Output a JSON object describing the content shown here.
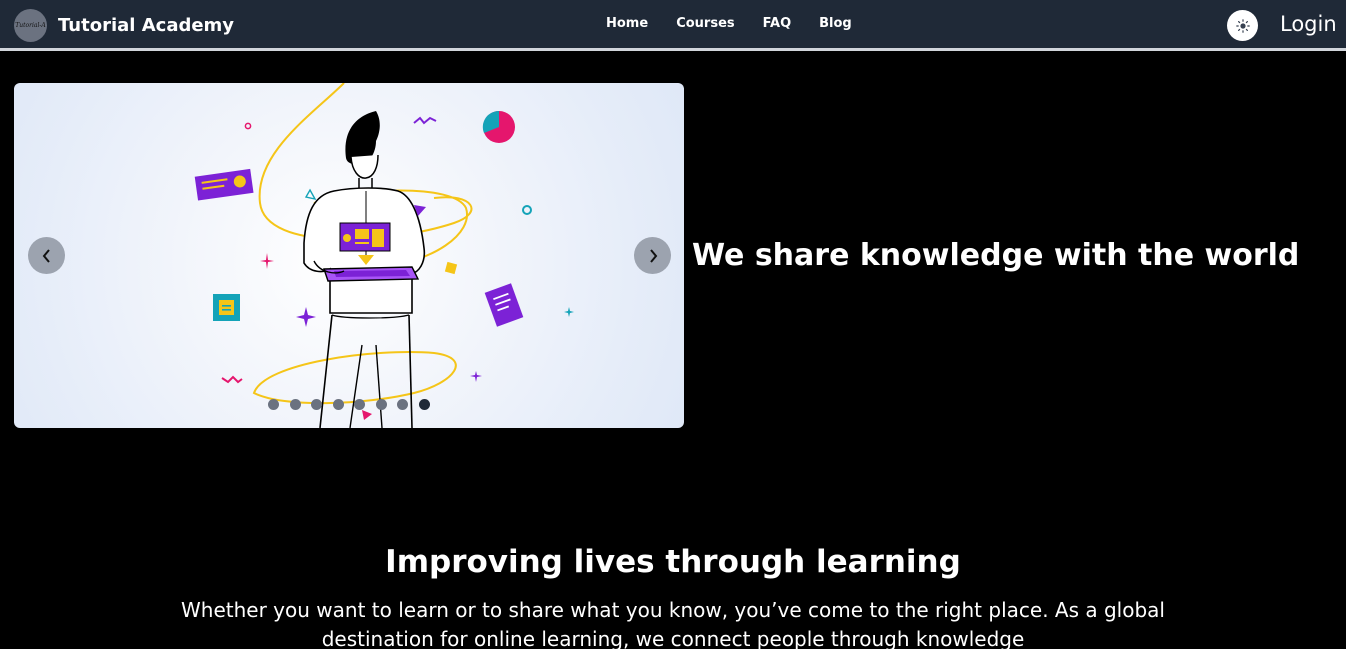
{
  "brand": {
    "logo_text": "Tutorial-A",
    "name": "Tutorial Academy"
  },
  "nav": {
    "items": [
      "Home",
      "Courses",
      "FAQ",
      "Blog"
    ]
  },
  "header": {
    "theme_toggle_icon": "sun-icon",
    "login_label": "Login"
  },
  "carousel": {
    "prev_icon": "chevron-left-icon",
    "next_icon": "chevron-right-icon",
    "slide_count": 8,
    "active_index": 7,
    "illustration": "person-with-tablet-illustration"
  },
  "hero": {
    "heading": "We share knowledge with the world"
  },
  "section": {
    "title": "Improving lives through learning",
    "text": "Whether you want to learn or to share what you know, you’ve come to the right place. As a global destination for online learning, we connect people through knowledge"
  },
  "colors": {
    "navbar_bg": "#1f2937",
    "page_bg": "#000000",
    "accent_purple": "#7c22d6",
    "accent_yellow": "#f5c518",
    "accent_pink": "#e5166d",
    "accent_teal": "#14a3b8"
  }
}
